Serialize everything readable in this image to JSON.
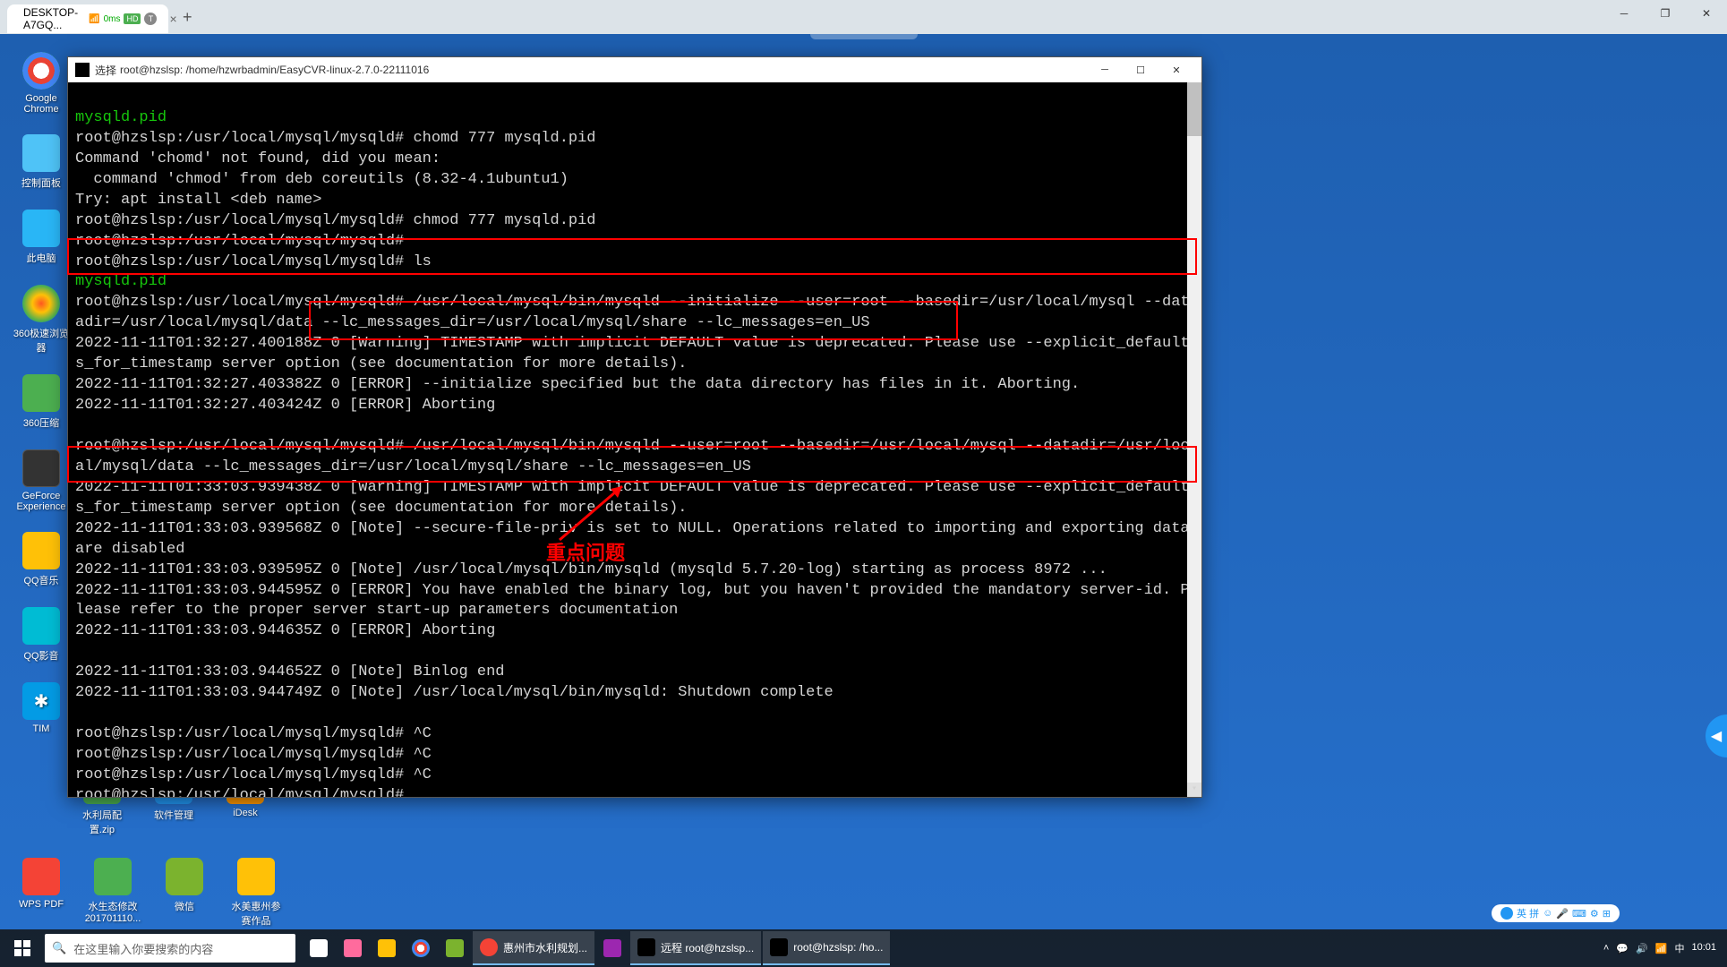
{
  "browser": {
    "tab_title": "DESKTOP-A7GQ...",
    "latency": "0ms",
    "badge_hd": "HD",
    "badge_t": "T"
  },
  "desktop_icons": {
    "chrome": "Google Chrome",
    "control_panel": "控制面板",
    "this_pc": "此电脑",
    "browser_360": "360极速浏览器",
    "zip_360": "360压缩",
    "geforce": "GeForce Experience",
    "qq_music": "QQ音乐",
    "qq_video": "QQ影音",
    "tim": "TIM",
    "row2_zip": "水利局配置.zip",
    "row2_2": "软件管理",
    "row2_3": "iDesk",
    "wps": "WPS PDF",
    "water_doc": "水生态修改201701110...",
    "wechat": "微信",
    "folder": "水美惠州参赛作品"
  },
  "terminal": {
    "title_prefix": "选择",
    "title": "root@hzslsp: /home/hzwrbadmin/EasyCVR-linux-2.7.0-22111016",
    "lines": {
      "l1": "mysqld.pid",
      "l2": "root@hzslsp:/usr/local/mysql/mysqld# chomd 777 mysqld.pid",
      "l3": "Command 'chomd' not found, did you mean:",
      "l4": "  command 'chmod' from deb coreutils (8.32-4.1ubuntu1)",
      "l5": "Try: apt install <deb name>",
      "l6": "root@hzslsp:/usr/local/mysql/mysqld# chmod 777 mysqld.pid",
      "l7": "root@hzslsp:/usr/local/mysql/mysqld#",
      "l8": "root@hzslsp:/usr/local/mysql/mysqld# ls",
      "l9": "mysqld.pid",
      "l10": "root@hzslsp:/usr/local/mysql/mysqld# /usr/local/mysql/bin/mysqld --initialize --user=root --basedir=/usr/local/mysql --datadir=/usr/local/mysql/data --lc_messages_dir=/usr/local/mysql/share --lc_messages=en_US",
      "l11": "2022-11-11T01:32:27.400188Z 0 [Warning] TIMESTAMP with implicit DEFAULT value is deprecated. Please use --explicit_defaults_for_timestamp server option (see documentation for more details).",
      "l12": "2022-11-11T01:32:27.403382Z 0 [ERROR] --initialize specified but the data directory has files in it. Aborting.",
      "l13": "2022-11-11T01:32:27.403424Z 0 [ERROR] Aborting",
      "l14": "root@hzslsp:/usr/local/mysql/mysqld# /usr/local/mysql/bin/mysqld --user=root --basedir=/usr/local/mysql --datadir=/usr/local/mysql/data --lc_messages_dir=/usr/local/mysql/share --lc_messages=en_US",
      "l15": "2022-11-11T01:33:03.939438Z 0 [Warning] TIMESTAMP with implicit DEFAULT value is deprecated. Please use --explicit_defaults_for_timestamp server option (see documentation for more details).",
      "l16": "2022-11-11T01:33:03.939568Z 0 [Note] --secure-file-priv is set to NULL. Operations related to importing and exporting data are disabled",
      "l17": "2022-11-11T01:33:03.939595Z 0 [Note] /usr/local/mysql/bin/mysqld (mysqld 5.7.20-log) starting as process 8972 ...",
      "l18": "2022-11-11T01:33:03.944595Z 0 [ERROR] You have enabled the binary log, but you haven't provided the mandatory server-id. Please refer to the proper server start-up parameters documentation",
      "l19": "2022-11-11T01:33:03.944635Z 0 [ERROR] Aborting",
      "l20": "2022-11-11T01:33:03.944652Z 0 [Note] Binlog end",
      "l21": "2022-11-11T01:33:03.944749Z 0 [Note] /usr/local/mysql/bin/mysqld: Shutdown complete",
      "l22": "root@hzslsp:/usr/local/mysql/mysqld# ^C",
      "l23": "root@hzslsp:/usr/local/mysql/mysqld# ^C",
      "l24": "root@hzslsp:/usr/local/mysql/mysqld# ^C",
      "l25": "root@hzslsp:/usr/local/mysql/mysqld#"
    }
  },
  "annotation": {
    "label": "重点问题"
  },
  "taskbar": {
    "search_placeholder": "在这里输入你要搜索的内容",
    "item1": "惠州市水利规划...",
    "item2": "远程 root@hzslsp...",
    "item3": "root@hzslsp: /ho...",
    "tray_pill": "英 拼",
    "time": "10:01"
  }
}
